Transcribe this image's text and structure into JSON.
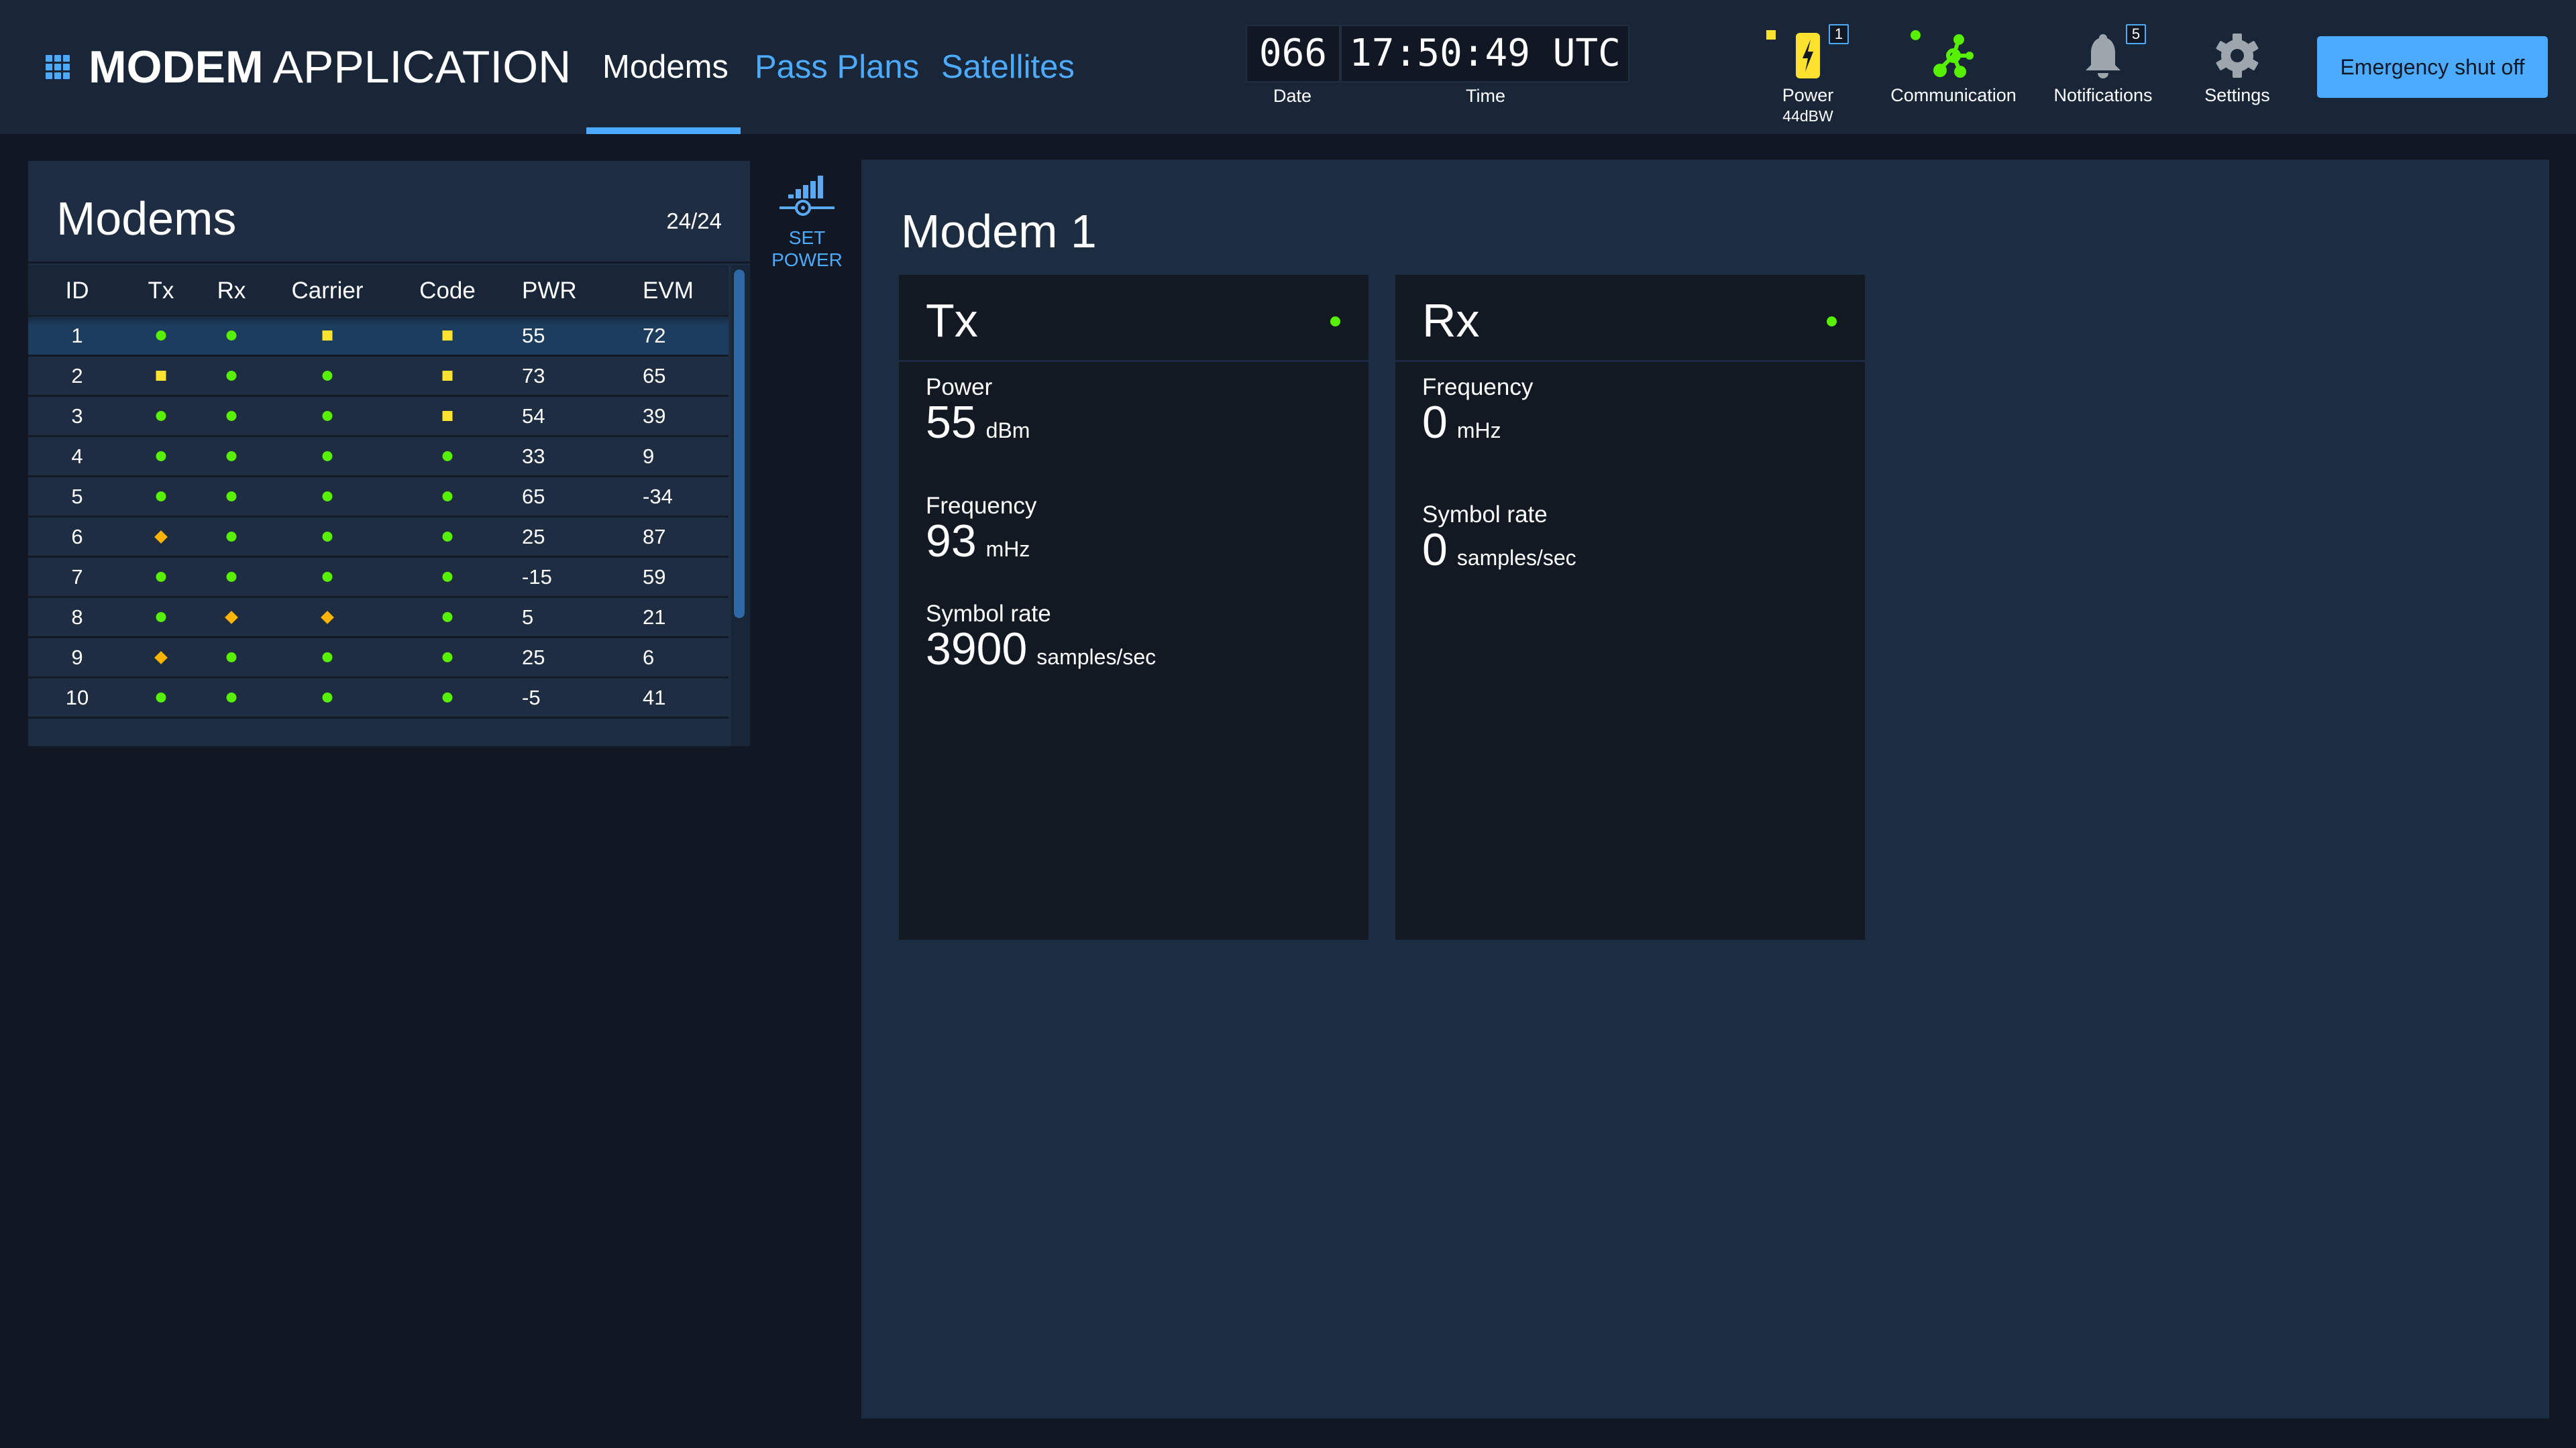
{
  "header": {
    "app_title_bold": "MODEM",
    "app_title_light": "APPLICATION",
    "nav": [
      {
        "label": "Modems",
        "active": true
      },
      {
        "label": "Pass Plans",
        "active": false
      },
      {
        "label": "Satellites",
        "active": false
      }
    ],
    "clock": {
      "date_value": "066",
      "time_value": "17:50:49 UTC",
      "date_label": "Date",
      "time_label": "Time"
    },
    "status": {
      "power": {
        "label": "Power",
        "sub": "44dBW",
        "badge": "1",
        "status": "caution"
      },
      "communication": {
        "label": "Communication",
        "status": "normal"
      },
      "notifications": {
        "label": "Notifications",
        "badge": "5"
      },
      "settings": {
        "label": "Settings"
      }
    },
    "emergency_button": "Emergency shut off"
  },
  "modems_panel": {
    "title": "Modems",
    "count": "24/24",
    "columns": [
      "ID",
      "Tx",
      "Rx",
      "Carrier",
      "Code",
      "PWR",
      "EVM"
    ],
    "rows": [
      {
        "id": "1",
        "tx": "normal",
        "rx": "normal",
        "carrier": "caution",
        "code": "caution",
        "pwr": "55",
        "evm": "72",
        "selected": true
      },
      {
        "id": "2",
        "tx": "caution",
        "rx": "normal",
        "carrier": "normal",
        "code": "caution",
        "pwr": "73",
        "evm": "65"
      },
      {
        "id": "3",
        "tx": "normal",
        "rx": "normal",
        "carrier": "normal",
        "code": "caution",
        "pwr": "54",
        "evm": "39"
      },
      {
        "id": "4",
        "tx": "normal",
        "rx": "normal",
        "carrier": "normal",
        "code": "normal",
        "pwr": "33",
        "evm": "9"
      },
      {
        "id": "5",
        "tx": "normal",
        "rx": "normal",
        "carrier": "normal",
        "code": "normal",
        "pwr": "65",
        "evm": "-34"
      },
      {
        "id": "6",
        "tx": "serious",
        "rx": "normal",
        "carrier": "normal",
        "code": "normal",
        "pwr": "25",
        "evm": "87"
      },
      {
        "id": "7",
        "tx": "normal",
        "rx": "normal",
        "carrier": "normal",
        "code": "normal",
        "pwr": "-15",
        "evm": "59"
      },
      {
        "id": "8",
        "tx": "normal",
        "rx": "serious",
        "carrier": "serious",
        "code": "normal",
        "pwr": "5",
        "evm": "21"
      },
      {
        "id": "9",
        "tx": "serious",
        "rx": "normal",
        "carrier": "normal",
        "code": "normal",
        "pwr": "25",
        "evm": "6"
      },
      {
        "id": "10",
        "tx": "normal",
        "rx": "normal",
        "carrier": "normal",
        "code": "normal",
        "pwr": "-5",
        "evm": "41"
      }
    ]
  },
  "set_power": {
    "line1": "SET",
    "line2": "POWER",
    "icon": "signal-slider-icon"
  },
  "detail": {
    "title": "Modem 1",
    "tx": {
      "title": "Tx",
      "status": "normal",
      "fields": [
        {
          "label": "Power",
          "value": "55",
          "unit": "dBm"
        },
        {
          "label": "Frequency",
          "value": "93",
          "unit": "mHz"
        },
        {
          "label": "Symbol rate",
          "value": "3900",
          "unit": "samples/sec"
        }
      ]
    },
    "rx": {
      "title": "Rx",
      "status": "normal",
      "fields": [
        {
          "label": "Frequency",
          "value": "0",
          "unit": "mHz"
        },
        {
          "label": "Symbol rate",
          "value": "0",
          "unit": "samples/sec"
        }
      ]
    }
  },
  "colors": {
    "accent": "#4dabff",
    "normal": "#56f000",
    "caution": "#fde230",
    "serious": "#ffb302",
    "header_bg": "#182638",
    "panel_bg": "#1c2c41",
    "app_bg": "#111823"
  }
}
